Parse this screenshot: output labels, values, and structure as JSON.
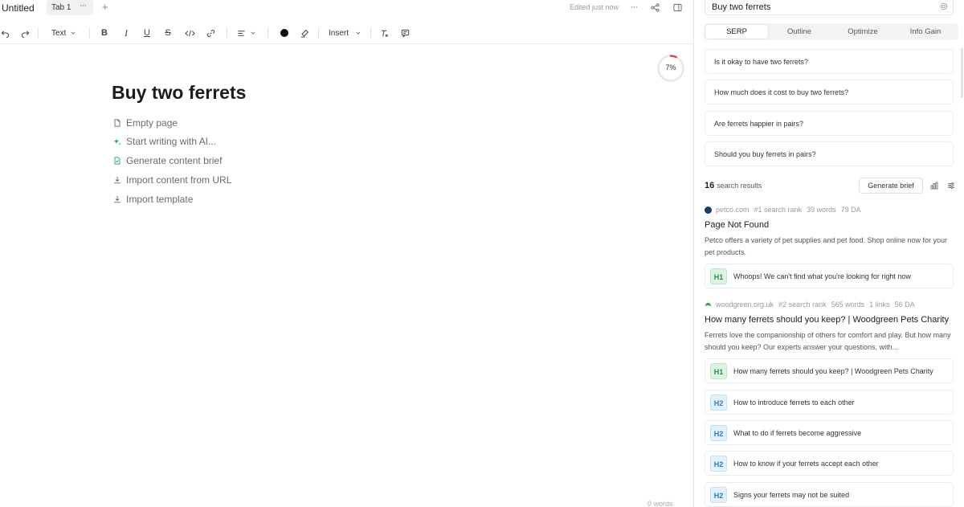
{
  "topbar": {
    "doc_title": "Untitled",
    "tab_label": "Tab 1",
    "tab_more": "···",
    "tab_add": "+",
    "edited_status": "Edited just now",
    "more": "···"
  },
  "toolbar": {
    "text_style": "Text",
    "insert": "Insert"
  },
  "editor": {
    "progress": "7%",
    "progress_fraction": 0.07,
    "title": "Buy two ferrets",
    "options": [
      {
        "label": "Empty page",
        "icon": "file-icon"
      },
      {
        "label": "Start writing with AI...",
        "icon": "sparkle-icon"
      },
      {
        "label": "Generate content brief",
        "icon": "brief-icon"
      },
      {
        "label": "Import content from URL",
        "icon": "download-icon"
      },
      {
        "label": "Import template",
        "icon": "download-icon"
      }
    ],
    "word_count": "0 words"
  },
  "panel": {
    "query": "Buy two ferrets",
    "tabs": [
      "SERP",
      "Outline",
      "Optimize",
      "Info Gain"
    ],
    "active_tab": "SERP",
    "questions": [
      "Is it okay to have two ferrets?",
      "How much does it cost to buy two ferrets?",
      "Are ferrets happier in pairs?",
      "Should you buy ferrets in pairs?"
    ],
    "results_count": "16",
    "results_label": "search results",
    "generate_brief": "Generate brief",
    "results": [
      {
        "domain": "petco.com",
        "rank": "#1 search rank",
        "words": "39 words",
        "links": "",
        "da": "79 DA",
        "favicon_color": "#1a3a6b",
        "title": "Page Not Found",
        "desc": "Petco offers a variety of pet supplies and pet food. Shop online now for your pet products.",
        "headings": [
          {
            "level": "H1",
            "text": "Whoops! We can't find what you're looking for right now"
          }
        ]
      },
      {
        "domain": "woodgreen.org.uk",
        "rank": "#2 search rank",
        "words": "565 words",
        "links": "1 links",
        "da": "56 DA",
        "favicon_color": "#3aa64a",
        "title": "How many ferrets should you keep? | Woodgreen Pets Charity",
        "desc": "Ferrets love the companionship of others for comfort and play. But how many should you keep? Our experts answer your questions, with...",
        "headings": [
          {
            "level": "H1",
            "text": "How many ferrets should you keep? | Woodgreen Pets Charity"
          },
          {
            "level": "H2",
            "text": "How to introduce ferrets to each other"
          },
          {
            "level": "H2",
            "text": "What to do if ferrets become aggressive"
          },
          {
            "level": "H2",
            "text": "How to know if your ferrets accept each other"
          },
          {
            "level": "H2",
            "text": "Signs your ferrets may not be suited"
          }
        ]
      }
    ]
  }
}
